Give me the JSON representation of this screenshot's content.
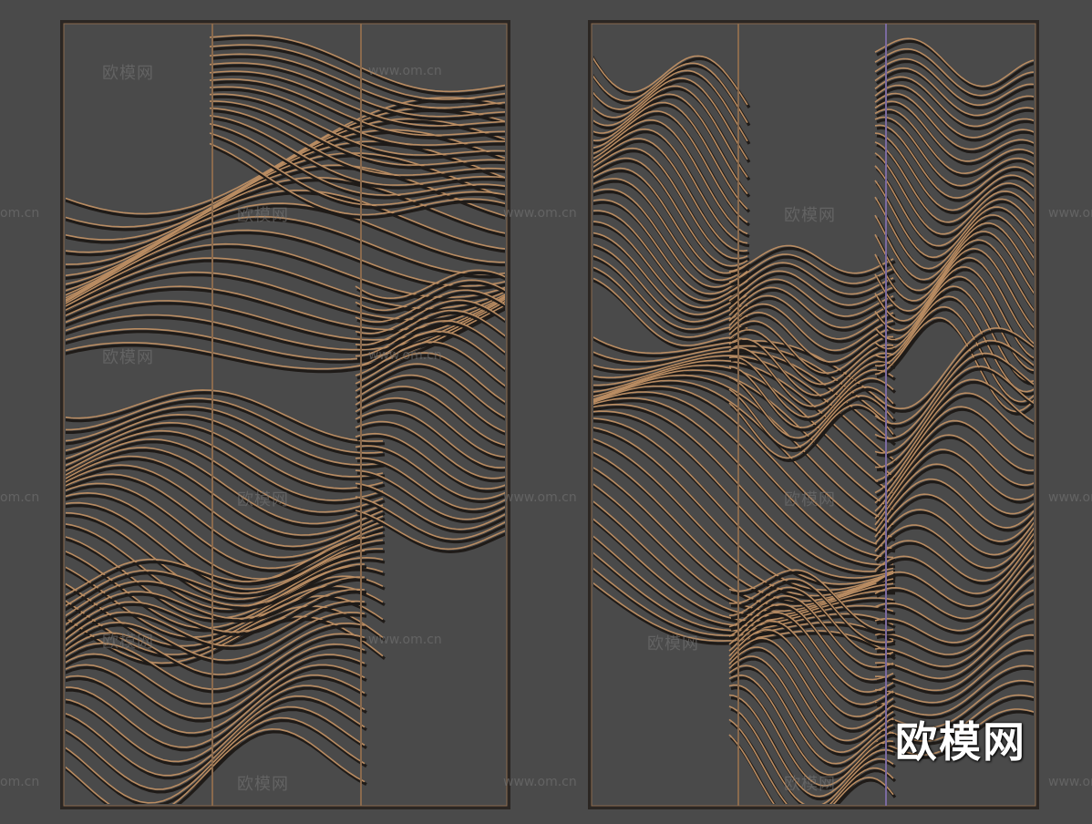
{
  "image": {
    "description": "Rendered 3D model of two decorative laser-cut metal screen panels with flowing wave line patterns on dark grey background",
    "colors": {
      "background": "#4a4a4a",
      "panel_frame": "#2b2623",
      "line_color": "#b98c62",
      "line_shadow": "#1f1b18"
    }
  },
  "watermarks": {
    "site_name": "欧模网",
    "site_url": "www.om.cn",
    "edge_url": "om.cn",
    "big_logo": "欧模网"
  }
}
